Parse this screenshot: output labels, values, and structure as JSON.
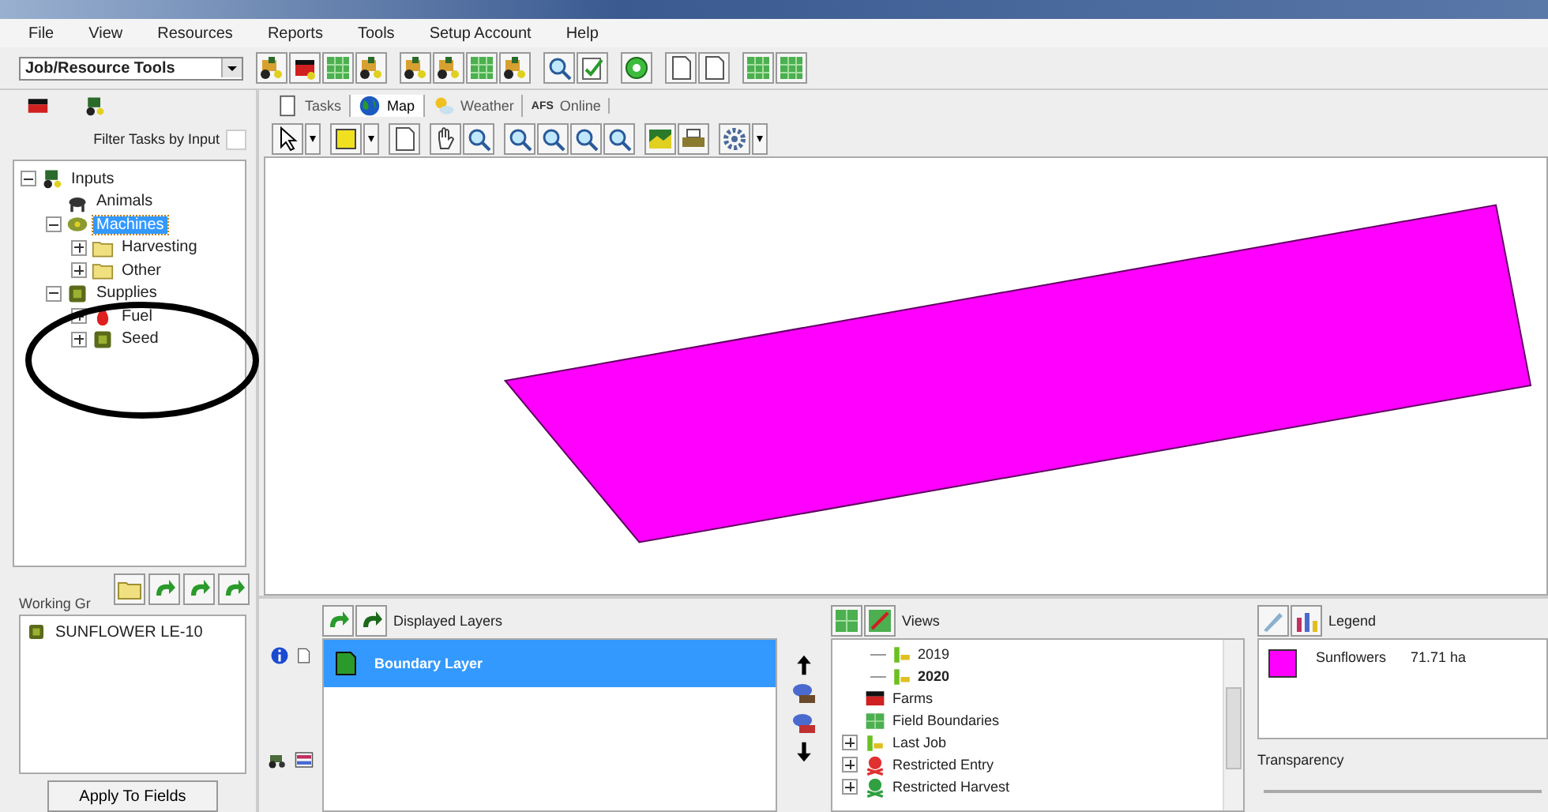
{
  "menu": [
    "File",
    "View",
    "Resources",
    "Reports",
    "Tools",
    "Setup Account",
    "Help"
  ],
  "tool_selector": {
    "value": "Job/Resource Tools"
  },
  "left_panel": {
    "filter": {
      "label": "Filter Tasks by Input",
      "checked": false
    },
    "tree": [
      {
        "label": "Inputs",
        "kind": "group",
        "expanded": true,
        "selected": false,
        "children": [
          {
            "label": "Animals",
            "kind": "animal",
            "selected": false
          },
          {
            "label": "Machines",
            "kind": "machine",
            "expanded": true,
            "selected": true,
            "children": [
              {
                "label": "Harvesting",
                "kind": "folder",
                "expanded": false,
                "selected": false
              },
              {
                "label": "Other",
                "kind": "folder",
                "expanded": false,
                "selected": false
              }
            ]
          },
          {
            "label": "Supplies",
            "kind": "supply",
            "expanded": true,
            "selected": false,
            "children": [
              {
                "label": "Fuel",
                "kind": "fuel",
                "expanded": false,
                "selected": false
              },
              {
                "label": "Seed",
                "kind": "supply",
                "expanded": false,
                "selected": false
              }
            ]
          }
        ]
      }
    ],
    "working_group": {
      "label": "Working Gr",
      "items": [
        {
          "label": "SUNFLOWER LE-10"
        }
      ]
    },
    "apply_button": "Apply To Fields"
  },
  "tabs": [
    {
      "label": "Tasks",
      "kind": "tasks",
      "selected": false
    },
    {
      "label": "Map",
      "kind": "map",
      "selected": true
    },
    {
      "label": "Weather",
      "kind": "weather",
      "selected": false
    },
    {
      "label": "Online",
      "logo": "AFS",
      "kind": "online",
      "selected": false
    }
  ],
  "layers": {
    "title": "Displayed Layers",
    "items": [
      {
        "label": "Boundary Layer",
        "selected": true
      }
    ]
  },
  "views": {
    "title": "Views",
    "scrolled_children": [
      {
        "label": "2019",
        "selected": false
      },
      {
        "label": "2020",
        "selected": true
      }
    ],
    "items": [
      {
        "label": "Farms",
        "kind": "farm"
      },
      {
        "label": "Field Boundaries",
        "kind": "boundary"
      },
      {
        "label": "Last Job",
        "kind": "job",
        "expanded": false
      },
      {
        "label": "Restricted Entry",
        "kind": "restricted",
        "color": "#e03030",
        "expanded": false
      },
      {
        "label": "Restricted Harvest",
        "kind": "restricted",
        "color": "#30a040",
        "expanded": false
      }
    ]
  },
  "legend": {
    "title": "Legend",
    "items": [
      {
        "label": "Sunflowers",
        "area": "71.71 ha",
        "color": "#ff00ff"
      }
    ],
    "transparency_label": "Transparency"
  }
}
